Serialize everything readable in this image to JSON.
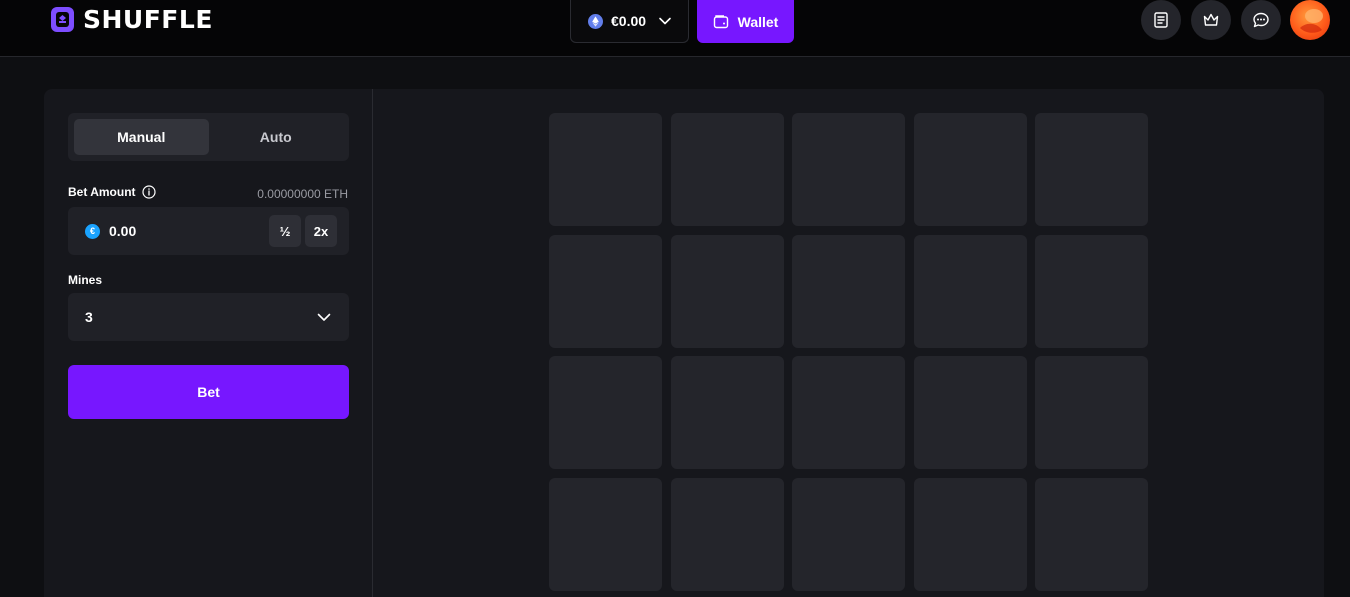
{
  "header": {
    "logo_text": "SHUFFLE",
    "balance": "€0.00",
    "wallet_label": "Wallet",
    "icons": [
      "receipt-icon",
      "crown-icon",
      "chat-icon"
    ],
    "accent_color": "#7717ff"
  },
  "sidebar": {
    "tabs": [
      {
        "label": "Manual",
        "active": true
      },
      {
        "label": "Auto",
        "active": false
      }
    ],
    "bet_amount": {
      "label": "Bet Amount",
      "crypto_value": "0.00000000 ETH",
      "value": "0.00",
      "half_label": "½",
      "double_label": "2x"
    },
    "mines": {
      "label": "Mines",
      "value": "3"
    },
    "bet_label": "Bet"
  },
  "board": {
    "columns": 5,
    "visible_rows": 4,
    "tiles": 20
  }
}
